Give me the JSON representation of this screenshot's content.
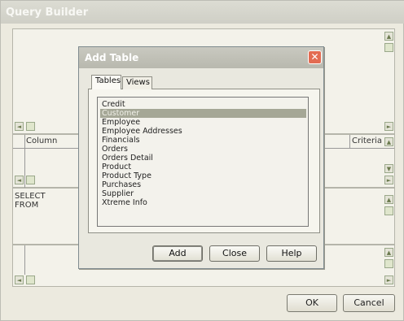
{
  "query_builder": {
    "title": "Query Builder",
    "grid_headers": {
      "column": "Column",
      "criteria": "Criteria"
    },
    "sql_lines": [
      "SELECT",
      "FROM"
    ],
    "ok_label": "OK",
    "cancel_label": "Cancel"
  },
  "dialog": {
    "title": "Add Table",
    "close_glyph": "✕",
    "tabs": [
      {
        "label": "Tables",
        "active": true
      },
      {
        "label": "Views",
        "active": false
      }
    ],
    "tables": [
      "Credit",
      "Customer",
      "Employee",
      "Employee Addresses",
      "Financials",
      "Orders",
      "Orders Detail",
      "Product",
      "Product Type",
      "Purchases",
      "Supplier",
      "Xtreme Info"
    ],
    "selected_index": 1,
    "buttons": {
      "add": "Add",
      "close": "Close",
      "help": "Help"
    }
  },
  "icons": {
    "scroll_up": "▲",
    "scroll_down": "▼",
    "scroll_left": "◄",
    "scroll_right": "►"
  },
  "colors": {
    "selection": "#a5a796",
    "close_button": "#e36c52"
  }
}
